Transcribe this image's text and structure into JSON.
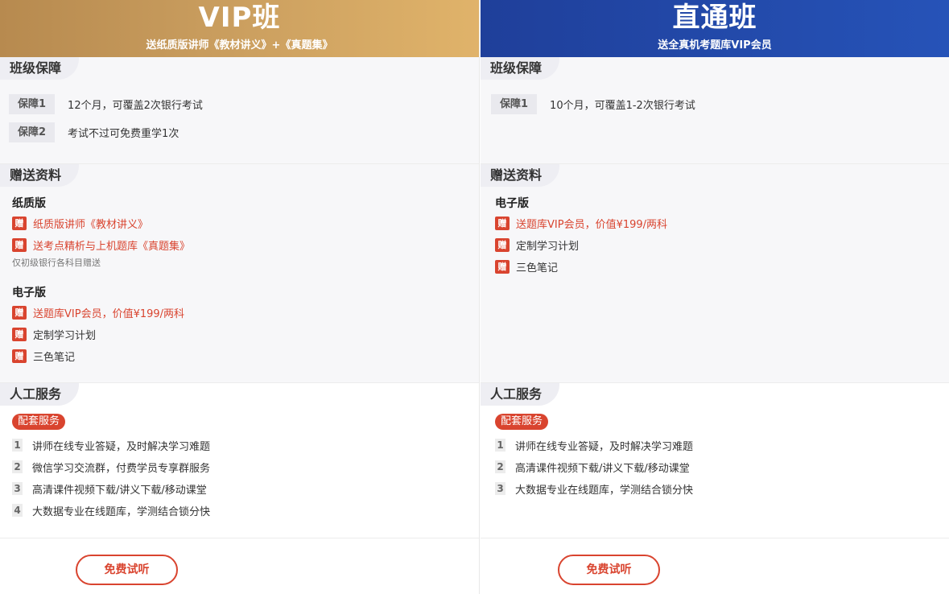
{
  "vip": {
    "title": "VIP班",
    "subtitle": "送纸质版讲师《教材讲义》+《真题集》",
    "guarantee": {
      "heading": "班级保障",
      "items": [
        {
          "badge": "保障1",
          "text": "12个月，可覆盖2次银行考试"
        },
        {
          "badge": "保障2",
          "text": "考试不过可免费重学1次"
        }
      ]
    },
    "gifts": {
      "heading": "赠送资料",
      "paper_title": "纸质版",
      "paper_items": [
        "纸质版讲师《教材讲义》",
        "送考点精析与上机题库《真题集》"
      ],
      "paper_note": "仅初级银行各科目赠送",
      "digital_title": "电子版",
      "digital_items": [
        "送题库VIP会员，价值¥199/两科",
        "定制学习计划",
        "三色笔记"
      ]
    },
    "service": {
      "heading": "人工服务",
      "pill": "配套服务",
      "items": [
        {
          "num": "1",
          "text": "讲师在线专业答疑，及时解决学习难题"
        },
        {
          "num": "2",
          "text": "微信学习交流群，付费学员专享群服务"
        },
        {
          "num": "3",
          "text": "高清课件视频下载/讲义下载/移动课堂"
        },
        {
          "num": "4",
          "text": "大数据专业在线题库，学测结合锁分快"
        }
      ]
    },
    "button": "免费试听"
  },
  "direct": {
    "title": "直通班",
    "subtitle": "送全真机考题库VIP会员",
    "guarantee": {
      "heading": "班级保障",
      "items": [
        {
          "badge": "保障1",
          "text": "10个月，可覆盖1-2次银行考试"
        }
      ]
    },
    "gifts": {
      "heading": "赠送资料",
      "digital_title": "电子版",
      "digital_items": [
        "送题库VIP会员，价值¥199/两科",
        "定制学习计划",
        "三色笔记"
      ]
    },
    "service": {
      "heading": "人工服务",
      "pill": "配套服务",
      "items": [
        {
          "num": "1",
          "text": "讲师在线专业答疑，及时解决学习难题"
        },
        {
          "num": "2",
          "text": "高清课件视频下载/讲义下载/移动课堂"
        },
        {
          "num": "3",
          "text": "大数据专业在线题库，学测结合锁分快"
        }
      ]
    },
    "button": "免费试听"
  },
  "gift_icon_char": "赠",
  "colors": {
    "accent_red": "#d9442f",
    "gold": "#c99d5e",
    "blue": "#2653b8"
  }
}
